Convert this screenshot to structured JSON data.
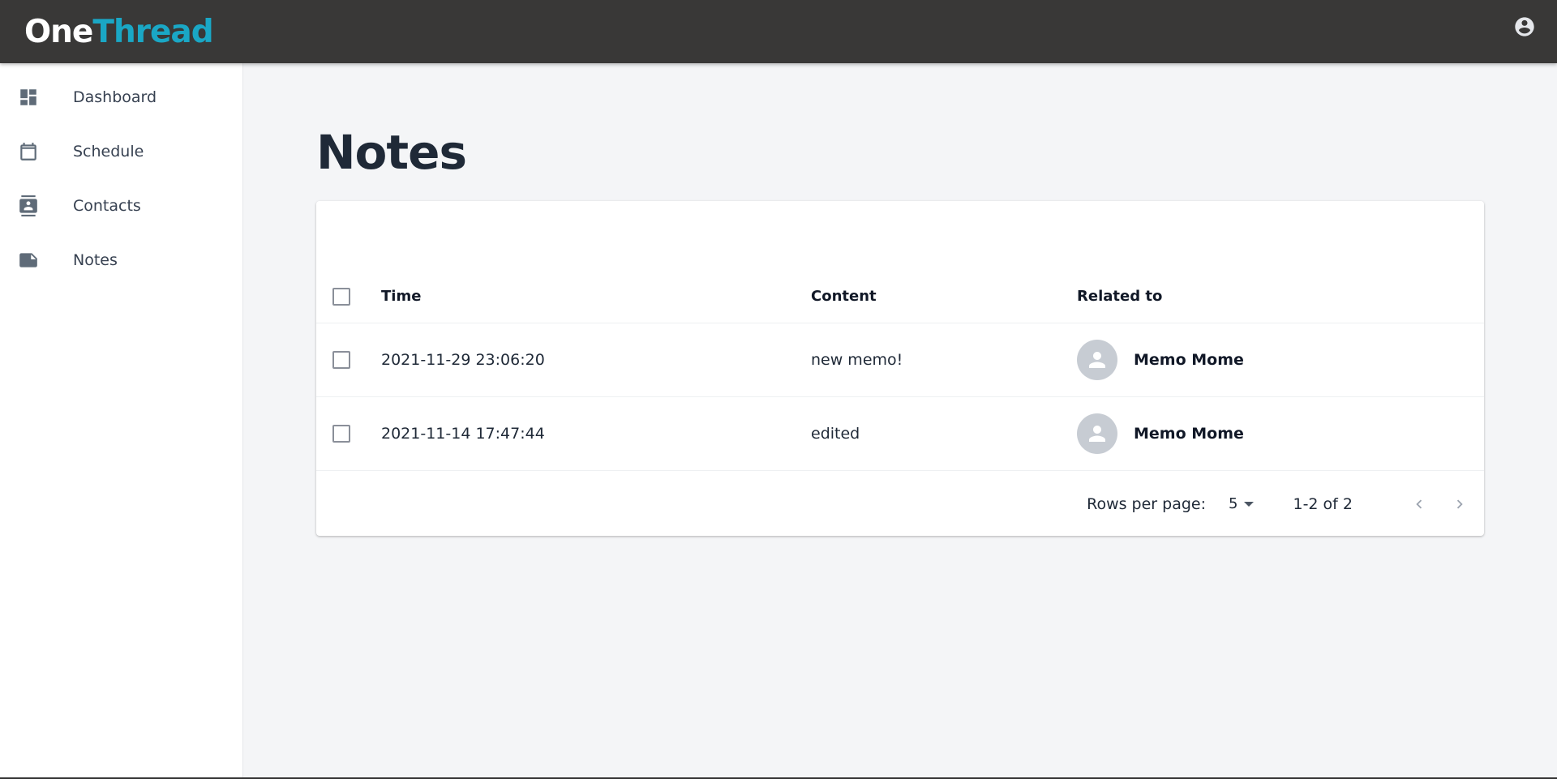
{
  "app": {
    "logo_part1": "One",
    "logo_part2": "Thread"
  },
  "sidebar": {
    "items": [
      {
        "label": "Dashboard",
        "icon": "dashboard-icon"
      },
      {
        "label": "Schedule",
        "icon": "calendar-icon"
      },
      {
        "label": "Contacts",
        "icon": "contacts-icon"
      },
      {
        "label": "Notes",
        "icon": "note-icon"
      }
    ]
  },
  "page": {
    "title": "Notes"
  },
  "table": {
    "headers": {
      "time": "Time",
      "content": "Content",
      "related": "Related to"
    },
    "rows": [
      {
        "time": "2021-11-29 23:06:20",
        "content": "new memo!",
        "related": "Memo Mome"
      },
      {
        "time": "2021-11-14 17:47:44",
        "content": "edited",
        "related": "Memo Mome"
      }
    ]
  },
  "pagination": {
    "rows_per_page_label": "Rows per page:",
    "rows_per_page_value": "5",
    "range": "1-2 of 2"
  },
  "colors": {
    "topbar": "#393837",
    "logo_accent": "#1aa7c5",
    "sidebar_icon": "#5f6b78"
  }
}
